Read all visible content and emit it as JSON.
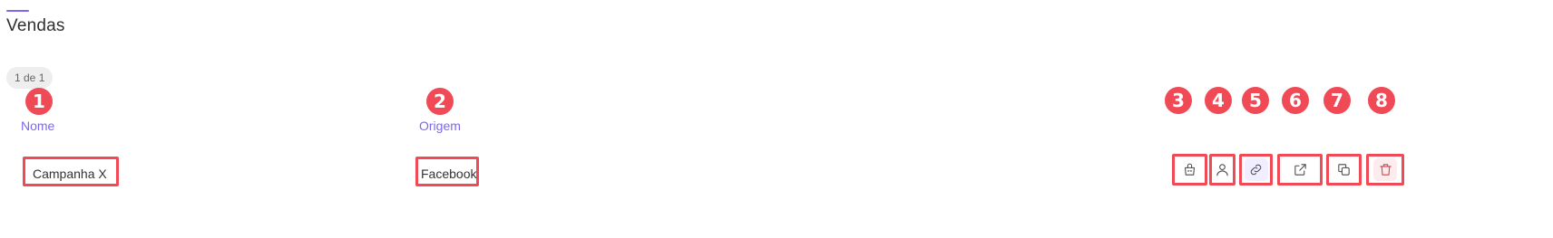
{
  "page": {
    "title": "Vendas",
    "pagination": "1 de 1",
    "accent_color": "#7b68ee",
    "callout_color": "#ef4a55"
  },
  "callouts": [
    "1",
    "2",
    "3",
    "4",
    "5",
    "6",
    "7",
    "8"
  ],
  "table": {
    "columns": [
      "Nome",
      "Origem"
    ],
    "rows": [
      {
        "nome": "Campanha X",
        "origem": "Facebook"
      }
    ]
  },
  "row_actions": [
    {
      "icon": "bag-icon"
    },
    {
      "icon": "user-icon"
    },
    {
      "icon": "link-icon"
    },
    {
      "icon": "external-link-icon"
    },
    {
      "icon": "copy-icon"
    },
    {
      "icon": "trash-icon"
    }
  ]
}
